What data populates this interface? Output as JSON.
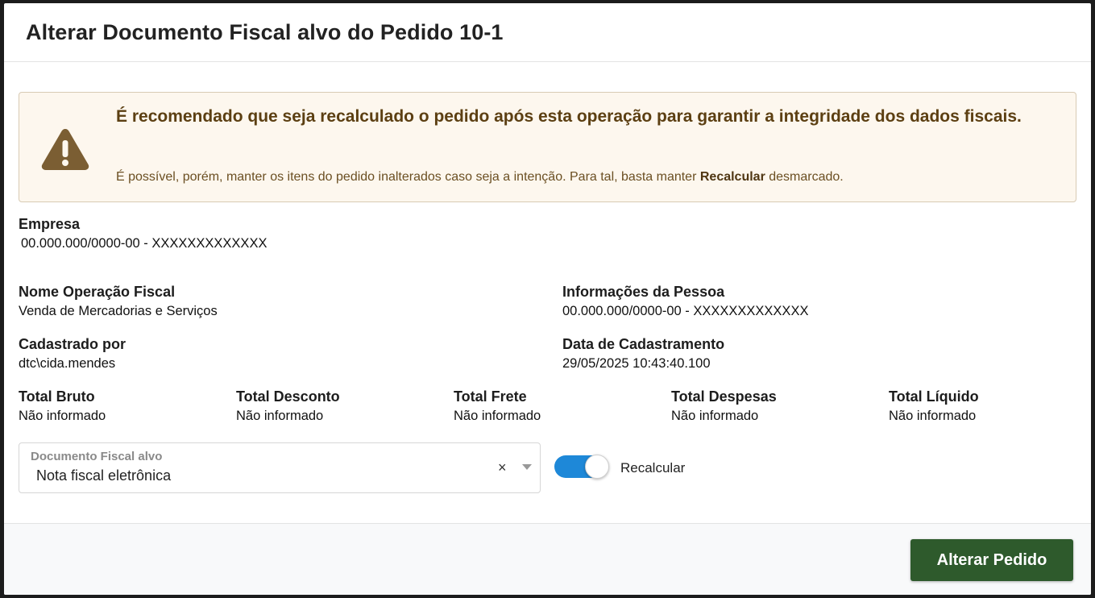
{
  "modal": {
    "title": "Alterar Documento Fiscal alvo do Pedido 10-1"
  },
  "alert": {
    "icon": "warning-triangle-icon",
    "title": "É recomendado que seja recalculado o pedido após esta operação para garantir a integridade dos dados fiscais.",
    "text_before": "É possível, porém, manter os itens do pedido inalterados caso seja a intenção. Para tal, basta manter ",
    "text_bold": "Recalcular",
    "text_after": " desmarcado.",
    "background_color": "#fdf7ee",
    "text_color": "#5c3f12"
  },
  "fields": {
    "empresa": {
      "label": "Empresa",
      "value": "00.000.000/0000-00 - XXXXXXXXXXXXX"
    },
    "operacao": {
      "label": "Nome Operação Fiscal",
      "value": "Venda de Mercadorias e Serviços"
    },
    "pessoa": {
      "label": "Informações da Pessoa",
      "value": "00.000.000/0000-00 - XXXXXXXXXXXXX"
    },
    "cadastrado_por": {
      "label": "Cadastrado por",
      "value": "dtc\\cida.mendes"
    },
    "data_cadastro": {
      "label": "Data de Cadastramento",
      "value": "29/05/2025 10:43:40.100"
    }
  },
  "totals": [
    {
      "label": "Total Bruto",
      "value": "Não informado"
    },
    {
      "label": "Total Desconto",
      "value": "Não informado"
    },
    {
      "label": "Total Frete",
      "value": "Não informado"
    },
    {
      "label": "Total Despesas",
      "value": "Não informado"
    },
    {
      "label": "Total Líquido",
      "value": "Não informado"
    }
  ],
  "documento_select": {
    "label": "Documento Fiscal alvo",
    "value": "Nota fiscal eletrônica",
    "clear_symbol": "×"
  },
  "recalcular": {
    "label": "Recalcular",
    "checked": true,
    "color": "#1e88d8"
  },
  "footer": {
    "submit_label": "Alterar Pedido",
    "submit_color": "#2e5a2c"
  }
}
